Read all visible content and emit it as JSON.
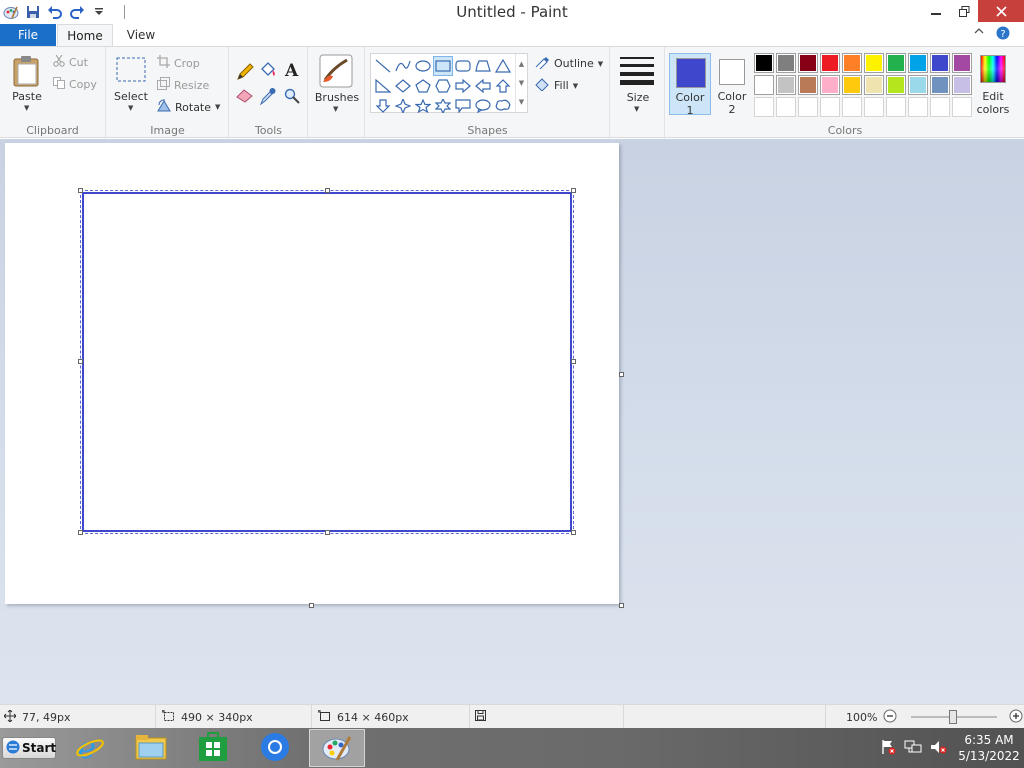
{
  "window": {
    "title": "Untitled - Paint",
    "controls": {
      "minimize_icon": "minimize-icon",
      "restore_icon": "restore-icon",
      "close_icon": "close-icon"
    }
  },
  "tabs": {
    "file": "File",
    "home": "Home",
    "view": "View"
  },
  "ribbon": {
    "clipboard": {
      "paste": "Paste",
      "cut": "Cut",
      "copy": "Copy",
      "group": "Clipboard"
    },
    "image": {
      "select": "Select",
      "crop": "Crop",
      "resize": "Resize",
      "rotate": "Rotate",
      "group": "Image"
    },
    "tools": {
      "group": "Tools"
    },
    "brushes": {
      "label": "Brushes"
    },
    "shapes": {
      "outline": "Outline",
      "fill": "Fill",
      "group": "Shapes",
      "selected": "rectangle"
    },
    "size": {
      "label": "Size"
    },
    "colors": {
      "color1_label": "Color",
      "color1_num": "1",
      "color1_value": "#3f48cc",
      "color2_label": "Color",
      "color2_num": "2",
      "color2_value": "#ffffff",
      "edit_label1": "Edit",
      "edit_label2": "colors",
      "group": "Colors",
      "palette_row1": [
        "#000000",
        "#7f7f7f",
        "#880015",
        "#ed1c24",
        "#ff7f27",
        "#fff200",
        "#22b14c",
        "#00a2e8",
        "#3f48cc",
        "#a349a4"
      ],
      "palette_row2": [
        "#ffffff",
        "#c3c3c3",
        "#b97a57",
        "#ffaec9",
        "#ffc90e",
        "#efe4b0",
        "#b5e61d",
        "#99d9ea",
        "#7092be",
        "#c8bfe7"
      ]
    }
  },
  "status": {
    "cursor_pos": "77, 49px",
    "selection_size": "490 × 340px",
    "image_size": "614 × 460px",
    "zoom": "100%"
  },
  "taskbar": {
    "start": "Start",
    "time": "6:35 AM",
    "date": "5/13/2022"
  }
}
